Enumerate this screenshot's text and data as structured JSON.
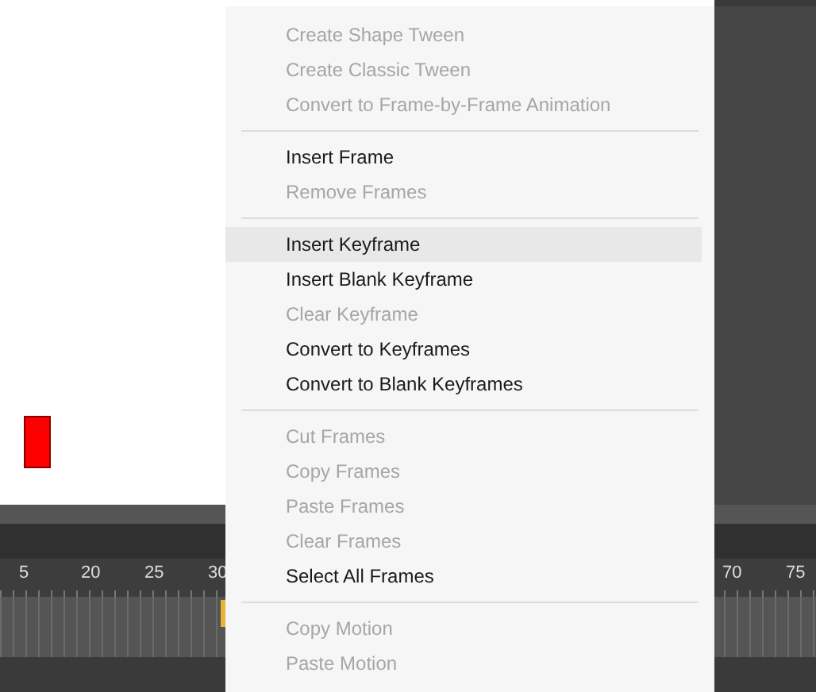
{
  "stage": {
    "shapes": [
      {
        "kind": "rectangle",
        "color": "#ff0000"
      }
    ]
  },
  "timeline": {
    "ruler_labels": [
      "5",
      "20",
      "25",
      "30",
      "70",
      "75"
    ]
  },
  "context_menu": {
    "groups": [
      {
        "items": [
          {
            "label": "Create Shape Tween",
            "disabled": true,
            "selected": false
          },
          {
            "label": "Create Classic Tween",
            "disabled": true,
            "selected": false
          },
          {
            "label": "Convert to Frame-by-Frame Animation",
            "disabled": true,
            "selected": false
          }
        ]
      },
      {
        "items": [
          {
            "label": "Insert Frame",
            "disabled": false,
            "selected": false
          },
          {
            "label": "Remove Frames",
            "disabled": true,
            "selected": false
          }
        ]
      },
      {
        "items": [
          {
            "label": "Insert Keyframe",
            "disabled": false,
            "selected": true
          },
          {
            "label": "Insert Blank Keyframe",
            "disabled": false,
            "selected": false
          },
          {
            "label": "Clear Keyframe",
            "disabled": true,
            "selected": false
          },
          {
            "label": "Convert to Keyframes",
            "disabled": false,
            "selected": false
          },
          {
            "label": "Convert to Blank Keyframes",
            "disabled": false,
            "selected": false
          }
        ]
      },
      {
        "items": [
          {
            "label": "Cut Frames",
            "disabled": true,
            "selected": false
          },
          {
            "label": "Copy Frames",
            "disabled": true,
            "selected": false
          },
          {
            "label": "Paste Frames",
            "disabled": true,
            "selected": false
          },
          {
            "label": "Clear Frames",
            "disabled": true,
            "selected": false
          },
          {
            "label": "Select All Frames",
            "disabled": false,
            "selected": false
          }
        ]
      },
      {
        "items": [
          {
            "label": "Copy Motion",
            "disabled": true,
            "selected": false
          },
          {
            "label": "Paste Motion",
            "disabled": true,
            "selected": false
          }
        ]
      }
    ]
  }
}
